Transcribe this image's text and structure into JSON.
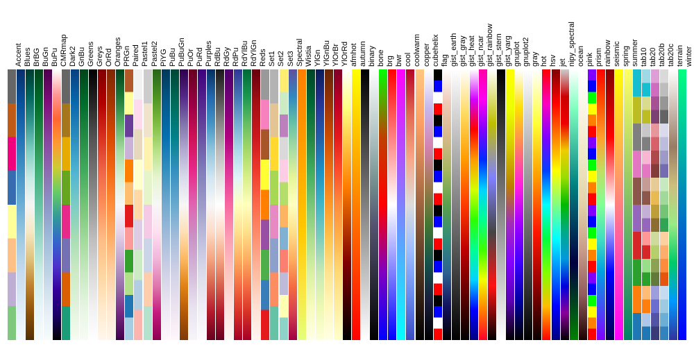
{
  "chart_data": {
    "type": "heatmap",
    "title": "",
    "colormaps": [
      {
        "name": "Accent",
        "colors": [
          "#7fc97f",
          "#beaed4",
          "#fdc086",
          "#ffff99",
          "#386cb0",
          "#f0027f",
          "#bf5b17",
          "#666666"
        ]
      },
      {
        "name": "Blues",
        "colors": [
          "#f7fbff",
          "#deebf7",
          "#c6dbef",
          "#9ecae1",
          "#6baed6",
          "#4292c6",
          "#2171b5",
          "#08519c",
          "#08306b"
        ]
      },
      {
        "name": "BrBG",
        "colors": [
          "#543005",
          "#8c510a",
          "#bf812d",
          "#dfc27d",
          "#f6e8c3",
          "#f5f5f5",
          "#c7eae5",
          "#80cdc1",
          "#35978f",
          "#01665e",
          "#003c30"
        ]
      },
      {
        "name": "BuGn",
        "colors": [
          "#f7fcfd",
          "#e5f5f9",
          "#ccece6",
          "#99d8c9",
          "#66c2a4",
          "#41ae76",
          "#238b45",
          "#006d2c",
          "#00441b"
        ]
      },
      {
        "name": "BuPu",
        "colors": [
          "#f7fcfd",
          "#e0ecf4",
          "#bfd3e6",
          "#9ebcda",
          "#8c96c6",
          "#8c6bb1",
          "#88419d",
          "#810f7c",
          "#4d004b"
        ]
      },
      {
        "name": "CMRmap",
        "colors": [
          "#000000",
          "#1a0066",
          "#330099",
          "#4d33cc",
          "#3366cc",
          "#339999",
          "#66cc66",
          "#cccc33",
          "#ff9933",
          "#ff6633",
          "#ff9999",
          "#ffffff"
        ]
      },
      {
        "name": "Dark2",
        "colors": [
          "#1b9e77",
          "#d95f02",
          "#7570b3",
          "#e7298a",
          "#66a61e",
          "#e6ab02",
          "#a6761d",
          "#666666"
        ]
      },
      {
        "name": "GnBu",
        "colors": [
          "#f7fcf0",
          "#e0f3db",
          "#ccebc5",
          "#a8ddb5",
          "#7bccc4",
          "#4eb3d3",
          "#2b8cbe",
          "#0868ac",
          "#084081"
        ]
      },
      {
        "name": "Greens",
        "colors": [
          "#f7fcf5",
          "#e5f5e0",
          "#c7e9c0",
          "#a1d99b",
          "#74c476",
          "#41ab5d",
          "#238b45",
          "#006d2c",
          "#00441b"
        ]
      },
      {
        "name": "Greys",
        "colors": [
          "#ffffff",
          "#f0f0f0",
          "#d9d9d9",
          "#bdbdbd",
          "#969696",
          "#737373",
          "#525252",
          "#252525",
          "#000000"
        ]
      },
      {
        "name": "OrRd",
        "colors": [
          "#fff7ec",
          "#fee8c8",
          "#fdd49e",
          "#fdbb84",
          "#fc8d59",
          "#ef6548",
          "#d7301f",
          "#b30000",
          "#7f0000"
        ]
      },
      {
        "name": "Oranges",
        "colors": [
          "#fff5eb",
          "#fee6ce",
          "#fdd0a2",
          "#fdae6b",
          "#fd8d3c",
          "#f16913",
          "#d94801",
          "#a63603",
          "#7f2704"
        ]
      },
      {
        "name": "PRGn",
        "colors": [
          "#40004b",
          "#762a83",
          "#9970ab",
          "#c2a5cf",
          "#e7d4e8",
          "#f7f7f7",
          "#d9f0d3",
          "#a6dba0",
          "#5aae61",
          "#1b7837",
          "#00441b"
        ]
      },
      {
        "name": "Paired",
        "colors": [
          "#a6cee3",
          "#1f78b4",
          "#b2df8a",
          "#33a02c",
          "#fb9a99",
          "#e31a1c",
          "#fdbf6f",
          "#ff7f00",
          "#cab2d6",
          "#6a3d9a",
          "#ffff99",
          "#b15928"
        ]
      },
      {
        "name": "Pastel1",
        "colors": [
          "#fbb4ae",
          "#b3cde3",
          "#ccebc5",
          "#decbe4",
          "#fed9a6",
          "#ffffcc",
          "#e5d8bd",
          "#fddaec",
          "#f2f2f2"
        ]
      },
      {
        "name": "Pastel2",
        "colors": [
          "#b3e2cd",
          "#fdcdac",
          "#cbd5e8",
          "#f4cae4",
          "#e6f5c9",
          "#fff2ae",
          "#f1e2cc",
          "#cccccc"
        ]
      },
      {
        "name": "PiYG",
        "colors": [
          "#8e0152",
          "#c51b7d",
          "#de77ae",
          "#f1b6da",
          "#fde0ef",
          "#f7f7f7",
          "#e6f5d0",
          "#b8e186",
          "#7fbc41",
          "#4d9221",
          "#276419"
        ]
      },
      {
        "name": "PuBu",
        "colors": [
          "#fff7fb",
          "#ece7f2",
          "#d0d1e6",
          "#a6bddb",
          "#74a9cf",
          "#3690c0",
          "#0570b0",
          "#045a8d",
          "#023858"
        ]
      },
      {
        "name": "PuBuGn",
        "colors": [
          "#fff7fb",
          "#ece2f0",
          "#d0d1e6",
          "#a6bddb",
          "#67a9cf",
          "#3690c0",
          "#02818a",
          "#016c59",
          "#014636"
        ]
      },
      {
        "name": "PuOr",
        "colors": [
          "#7f3b08",
          "#b35806",
          "#e08214",
          "#fdb863",
          "#fee0b6",
          "#f7f7f7",
          "#d8daeb",
          "#b2abd2",
          "#8073ac",
          "#542788",
          "#2d004b"
        ]
      },
      {
        "name": "PuRd",
        "colors": [
          "#f7f4f9",
          "#e7e1ef",
          "#d4b9da",
          "#c994c7",
          "#df65b0",
          "#e7298a",
          "#ce1256",
          "#980043",
          "#67001f"
        ]
      },
      {
        "name": "Purples",
        "colors": [
          "#fcfbfd",
          "#efedf5",
          "#dadaeb",
          "#bcbddc",
          "#9e9ac8",
          "#807dba",
          "#6a51a3",
          "#54278f",
          "#3f007d"
        ]
      },
      {
        "name": "RdBu",
        "colors": [
          "#67001f",
          "#b2182b",
          "#d6604d",
          "#f4a582",
          "#fddbc7",
          "#f7f7f7",
          "#d1e5f0",
          "#92c5de",
          "#4393c3",
          "#2166ac",
          "#053061"
        ]
      },
      {
        "name": "RdGy",
        "colors": [
          "#67001f",
          "#b2182b",
          "#d6604d",
          "#f4a582",
          "#fddbc7",
          "#ffffff",
          "#e0e0e0",
          "#bababa",
          "#878787",
          "#4d4d4d",
          "#1a1a1a"
        ]
      },
      {
        "name": "RdPu",
        "colors": [
          "#fff7f3",
          "#fde0dd",
          "#fcc5c0",
          "#fa9fb5",
          "#f768a1",
          "#dd3497",
          "#ae017e",
          "#7a0177",
          "#49006a"
        ]
      },
      {
        "name": "RdYlBu",
        "colors": [
          "#a50026",
          "#d73027",
          "#f46d43",
          "#fdae61",
          "#fee090",
          "#ffffbf",
          "#e0f3f8",
          "#abd9e9",
          "#74add1",
          "#4575b4",
          "#313695"
        ]
      },
      {
        "name": "RdYlGn",
        "colors": [
          "#a50026",
          "#d73027",
          "#f46d43",
          "#fdae61",
          "#fee08b",
          "#ffffbf",
          "#d9ef8b",
          "#a6d96a",
          "#66bd63",
          "#1a9850",
          "#006837"
        ]
      },
      {
        "name": "Reds",
        "colors": [
          "#fff5f0",
          "#fee0d2",
          "#fcbba1",
          "#fc9272",
          "#fb6a4a",
          "#ef3b2c",
          "#cb181d",
          "#a50f15",
          "#67000d"
        ]
      },
      {
        "name": "Set1",
        "colors": [
          "#e41a1c",
          "#377eb8",
          "#4daf4a",
          "#984ea3",
          "#ff7f00",
          "#ffff33",
          "#a65628",
          "#f781bf",
          "#999999"
        ]
      },
      {
        "name": "Set2",
        "colors": [
          "#66c2a5",
          "#fc8d62",
          "#8da0cb",
          "#e78ac3",
          "#a6d854",
          "#ffd92f",
          "#e5c494",
          "#b3b3b3"
        ]
      },
      {
        "name": "Set3",
        "colors": [
          "#8dd3c7",
          "#ffffb3",
          "#bebada",
          "#fb8072",
          "#80b1d3",
          "#fdb462",
          "#b3de69",
          "#fccde5",
          "#d9d9d9",
          "#bc80bd",
          "#ccebc5",
          "#ffed6f"
        ]
      },
      {
        "name": "Spectral",
        "colors": [
          "#9e0142",
          "#d53e4f",
          "#f46d43",
          "#fdae61",
          "#fee08b",
          "#ffffbf",
          "#e6f598",
          "#abdda4",
          "#66c2a5",
          "#3288bd",
          "#5e4fa2"
        ]
      },
      {
        "name": "Wistia",
        "colors": [
          "#e4ff7a",
          "#fce33e",
          "#ffc900",
          "#ffad00",
          "#fe9200",
          "#fc7f00"
        ]
      },
      {
        "name": "YlGn",
        "colors": [
          "#ffffe5",
          "#f7fcb9",
          "#d9f0a3",
          "#addd8e",
          "#78c679",
          "#41ab5d",
          "#238443",
          "#006837",
          "#004529"
        ]
      },
      {
        "name": "YlGnBu",
        "colors": [
          "#ffffd9",
          "#edf8b1",
          "#c7e9b4",
          "#7fcdbb",
          "#41b6c4",
          "#1d91c0",
          "#225ea8",
          "#253494",
          "#081d58"
        ]
      },
      {
        "name": "YlOrBr",
        "colors": [
          "#ffffe5",
          "#fff7bc",
          "#fee391",
          "#fec44f",
          "#fe9929",
          "#ec7014",
          "#cc4c02",
          "#993404",
          "#662506"
        ]
      },
      {
        "name": "YlOrRd",
        "colors": [
          "#ffffcc",
          "#ffeda0",
          "#fed976",
          "#feb24c",
          "#fd8d3c",
          "#fc4e2a",
          "#e31a1c",
          "#bd0026",
          "#800026"
        ]
      },
      {
        "name": "afmhot",
        "colors": [
          "#000000",
          "#400000",
          "#800000",
          "#c04000",
          "#ff8000",
          "#ffc040",
          "#ffff80",
          "#ffffff"
        ]
      },
      {
        "name": "autumn",
        "colors": [
          "#ff0000",
          "#ff4000",
          "#ff8000",
          "#ffbf00",
          "#ffff00"
        ]
      },
      {
        "name": "binary",
        "colors": [
          "#ffffff",
          "#000000"
        ]
      },
      {
        "name": "bone",
        "colors": [
          "#000000",
          "#1c1c26",
          "#38384d",
          "#545473",
          "#708b8b",
          "#a3b8b8",
          "#d1dcdc",
          "#ffffff"
        ]
      },
      {
        "name": "brg",
        "colors": [
          "#0000ff",
          "#8000bf",
          "#ff0000",
          "#bf4000",
          "#00ff00"
        ]
      },
      {
        "name": "bwr",
        "colors": [
          "#0000ff",
          "#8080ff",
          "#ffffff",
          "#ff8080",
          "#ff0000"
        ]
      },
      {
        "name": "cool",
        "colors": [
          "#00ffff",
          "#40bfff",
          "#8080ff",
          "#bf40ff",
          "#ff00ff"
        ]
      },
      {
        "name": "coolwarm",
        "colors": [
          "#3b4cc0",
          "#6a8bef",
          "#9ebeff",
          "#dcdcdc",
          "#f7a889",
          "#e26952",
          "#b40426"
        ]
      },
      {
        "name": "copper",
        "colors": [
          "#000000",
          "#3f2819",
          "#7e5033",
          "#bd784c",
          "#fc9f65",
          "#ffc77f"
        ]
      },
      {
        "name": "cubehelix",
        "colors": [
          "#000000",
          "#1a1d3b",
          "#15534b",
          "#437731",
          "#a0794d",
          "#d383b0",
          "#c6b8ed",
          "#ffffff"
        ]
      },
      {
        "name": "flag",
        "colors": [
          "#ff0000",
          "#ffffff",
          "#0000ff",
          "#000000",
          "#ff0000",
          "#ffffff",
          "#0000ff",
          "#000000",
          "#ff0000",
          "#ffffff",
          "#0000ff",
          "#000000",
          "#ff0000",
          "#ffffff",
          "#0000ff",
          "#000000",
          "#ff0000",
          "#ffffff",
          "#0000ff",
          "#000000",
          "#ff0000",
          "#ffffff",
          "#0000ff",
          "#000000"
        ]
      },
      {
        "name": "gist_earth",
        "colors": [
          "#000000",
          "#12125e",
          "#2e6391",
          "#328b77",
          "#5aa04e",
          "#a6b560",
          "#d6b98a",
          "#eec9b8",
          "#ffffff"
        ]
      },
      {
        "name": "gist_gray",
        "colors": [
          "#000000",
          "#404040",
          "#808080",
          "#bfbfbf",
          "#ffffff"
        ]
      },
      {
        "name": "gist_heat",
        "colors": [
          "#000000",
          "#5e0000",
          "#bd0000",
          "#ff3b00",
          "#ff9b00",
          "#ffd95e",
          "#ffffff"
        ]
      },
      {
        "name": "gist_ncar",
        "colors": [
          "#000080",
          "#0000ff",
          "#00d4ff",
          "#00ff91",
          "#2cff00",
          "#d4ff00",
          "#ff9b00",
          "#ff0000",
          "#d400ff",
          "#ffffff"
        ]
      },
      {
        "name": "gist_rainbow",
        "colors": [
          "#ff0029",
          "#ff8000",
          "#f2ff00",
          "#3dff00",
          "#00ff91",
          "#00d4ff",
          "#0029ff",
          "#8000ff",
          "#ff00f2",
          "#ff00a6"
        ]
      },
      {
        "name": "gist_stern",
        "colors": [
          "#000000",
          "#ff1212",
          "#454545",
          "#8080ff",
          "#bfbf00",
          "#ffffff"
        ]
      },
      {
        "name": "gist_yarg",
        "colors": [
          "#ffffff",
          "#bfbfbf",
          "#808080",
          "#404040",
          "#000000"
        ]
      },
      {
        "name": "gnuplot",
        "colors": [
          "#000000",
          "#5a00b2",
          "#8200ff",
          "#a12cbd",
          "#bc8000",
          "#d5cb00",
          "#ecff00",
          "#ffff00"
        ]
      },
      {
        "name": "gnuplot2",
        "colors": [
          "#000000",
          "#0000a0",
          "#4000ff",
          "#a000ff",
          "#ff20df",
          "#ff8060",
          "#ffe000",
          "#ffffff"
        ]
      },
      {
        "name": "gray",
        "colors": [
          "#000000",
          "#404040",
          "#808080",
          "#bfbfbf",
          "#ffffff"
        ]
      },
      {
        "name": "hot",
        "colors": [
          "#0b0000",
          "#900000",
          "#ff1700",
          "#ff9b00",
          "#ffff36",
          "#ffffff"
        ]
      },
      {
        "name": "hsv",
        "colors": [
          "#ff0000",
          "#ffbf00",
          "#80ff00",
          "#00ff40",
          "#00ffff",
          "#0040ff",
          "#8000ff",
          "#ff00bf",
          "#ff0000"
        ]
      },
      {
        "name": "jet",
        "colors": [
          "#000080",
          "#0000ff",
          "#0080ff",
          "#00ffff",
          "#80ff80",
          "#ffff00",
          "#ff8000",
          "#ff0000",
          "#800000"
        ]
      },
      {
        "name": "nipy_spectral",
        "colors": [
          "#000000",
          "#880099",
          "#0000dd",
          "#0099dd",
          "#00aa88",
          "#00bb00",
          "#99dd00",
          "#eecc00",
          "#ee0000",
          "#cc0000",
          "#cccccc"
        ]
      },
      {
        "name": "ocean",
        "colors": [
          "#008000",
          "#004020",
          "#000040",
          "#004060",
          "#008080",
          "#40bfa0",
          "#80ffc0",
          "#ffffff"
        ]
      },
      {
        "name": "pink",
        "colors": [
          "#1e0000",
          "#915c5c",
          "#c89c8a",
          "#e2d2a8",
          "#eee7c4",
          "#f8f4e2",
          "#ffffff"
        ]
      },
      {
        "name": "prism",
        "colors": [
          "#ff0000",
          "#ff8000",
          "#ffff00",
          "#00ff00",
          "#0000ff",
          "#8000ff",
          "#ff0000",
          "#ff8000",
          "#ffff00",
          "#00ff00",
          "#0000ff",
          "#8000ff",
          "#ff0000",
          "#ff8000",
          "#ffff00",
          "#00ff00",
          "#0000ff",
          "#8000ff",
          "#ff0000",
          "#ff8000",
          "#ffff00",
          "#00ff00",
          "#0000ff",
          "#8000ff"
        ]
      },
      {
        "name": "rainbow",
        "colors": [
          "#8000ff",
          "#4051f7",
          "#009ee1",
          "#40dfc0",
          "#80ff95",
          "#bfdf62",
          "#ff9e2b",
          "#ff5100",
          "#ff0000"
        ]
      },
      {
        "name": "seismic",
        "colors": [
          "#00004c",
          "#0000ff",
          "#ffffff",
          "#ff0000",
          "#800000"
        ]
      },
      {
        "name": "spring",
        "colors": [
          "#ff00ff",
          "#ff40bf",
          "#ff8080",
          "#ffbf40",
          "#ffff00"
        ]
      },
      {
        "name": "summer",
        "colors": [
          "#008066",
          "#40a066",
          "#80c066",
          "#bfdf66",
          "#ffff66"
        ]
      },
      {
        "name": "tab10",
        "colors": [
          "#1f77b4",
          "#ff7f0e",
          "#2ca02c",
          "#d62728",
          "#9467bd",
          "#8c564b",
          "#e377c2",
          "#7f7f7f",
          "#bcbd22",
          "#17becf"
        ]
      },
      {
        "name": "tab20",
        "colors": [
          "#1f77b4",
          "#aec7e8",
          "#ff7f0e",
          "#ffbb78",
          "#2ca02c",
          "#98df8a",
          "#d62728",
          "#ff9896",
          "#9467bd",
          "#c5b0d5",
          "#8c564b",
          "#c49c94",
          "#e377c2",
          "#f7b6d2",
          "#7f7f7f",
          "#c7c7c7",
          "#bcbd22",
          "#dbdb8d",
          "#17becf",
          "#9edae5"
        ]
      },
      {
        "name": "tab20b",
        "colors": [
          "#393b79",
          "#5254a3",
          "#6b6ecf",
          "#9c9ede",
          "#637939",
          "#8ca252",
          "#b5cf6b",
          "#cedb9c",
          "#8c6d31",
          "#bd9e39",
          "#e7ba52",
          "#e7cb94",
          "#843c39",
          "#ad494a",
          "#d6616b",
          "#e7969c",
          "#7b4173",
          "#a55194",
          "#ce6dbd",
          "#de9ed6"
        ]
      },
      {
        "name": "tab20c",
        "colors": [
          "#3182bd",
          "#6baed6",
          "#9ecae1",
          "#c6dbef",
          "#e6550d",
          "#fd8d3c",
          "#fdae6b",
          "#fdd0a2",
          "#31a354",
          "#74c476",
          "#a1d99b",
          "#c7e9c0",
          "#756bb1",
          "#9e9ac8",
          "#bcbddc",
          "#dadaeb",
          "#636363",
          "#969696",
          "#bdbdbd",
          "#d9d9d9"
        ]
      },
      {
        "name": "terrain",
        "colors": [
          "#333399",
          "#0099ff",
          "#00cc66",
          "#99eb85",
          "#ccbe7d",
          "#997c64",
          "#ccbeb2",
          "#ffffff"
        ]
      },
      {
        "name": "winter",
        "colors": [
          "#0000ff",
          "#0040df",
          "#0080bf",
          "#00bf9f",
          "#00ff80"
        ]
      }
    ]
  }
}
